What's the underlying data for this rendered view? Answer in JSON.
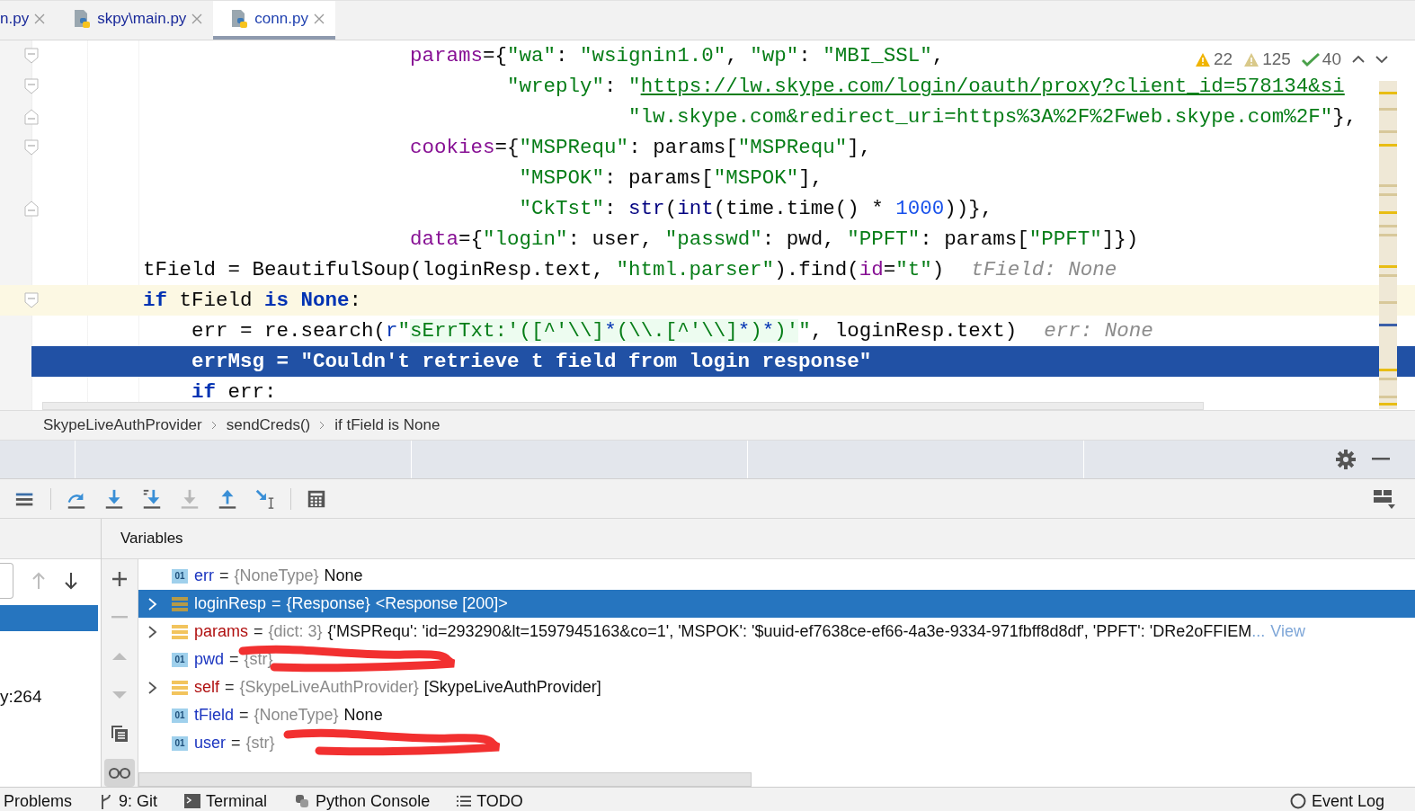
{
  "tabs": [
    {
      "label": "n.py",
      "selected": false,
      "python": false
    },
    {
      "label": "skpy\\main.py",
      "selected": false,
      "python": true
    },
    {
      "label": "conn.py",
      "selected": true,
      "python": true
    }
  ],
  "inspections": [
    {
      "kind": "error",
      "count": "22"
    },
    {
      "kind": "warning",
      "count": "125"
    },
    {
      "kind": "ok",
      "count": "40"
    }
  ],
  "code": [
    {
      "fold_start": true,
      "fold_end": false,
      "current": false,
      "selected": false,
      "tokens": [
        {
          "kind": "param",
          "t": "                      params"
        },
        {
          "kind": "plain",
          "t": "={"
        },
        {
          "kind": "str",
          "t": "\"wa\""
        },
        {
          "kind": "plain",
          "t": ": "
        },
        {
          "kind": "str",
          "t": "\"wsignin1.0\""
        },
        {
          "kind": "plain",
          "t": ", "
        },
        {
          "kind": "str",
          "t": "\"wp\""
        },
        {
          "kind": "plain",
          "t": ": "
        },
        {
          "kind": "str",
          "t": "\"MBI_SSL\""
        },
        {
          "kind": "plain",
          "t": ","
        }
      ]
    },
    {
      "fold_start": true,
      "fold_end": false,
      "current": false,
      "selected": false,
      "tokens": [
        {
          "kind": "str",
          "t": "                              \"wreply\""
        },
        {
          "kind": "plain",
          "t": ": "
        },
        {
          "kind": "str",
          "t": "\""
        },
        {
          "kind": "link",
          "t": "https://lw.skype.com/login/oauth/proxy?client_id=578134&si"
        }
      ]
    },
    {
      "fold_start": false,
      "fold_end": true,
      "current": false,
      "selected": false,
      "tokens": [
        {
          "kind": "str",
          "t": "                                        \"lw.skype.com&redirect_uri=https%3A%2F%2Fweb.skype.com%2F\""
        },
        {
          "kind": "plain",
          "t": "},"
        }
      ]
    },
    {
      "fold_start": true,
      "fold_end": false,
      "current": false,
      "selected": false,
      "tokens": [
        {
          "kind": "param",
          "t": "                      cookies"
        },
        {
          "kind": "plain",
          "t": "={"
        },
        {
          "kind": "str",
          "t": "\"MSPRequ\""
        },
        {
          "kind": "plain",
          "t": ": params["
        },
        {
          "kind": "str",
          "t": "\"MSPRequ\""
        },
        {
          "kind": "plain",
          "t": "],"
        }
      ]
    },
    {
      "fold_start": false,
      "fold_end": false,
      "current": false,
      "selected": false,
      "tokens": [
        {
          "kind": "str",
          "t": "                               \"MSPOK\""
        },
        {
          "kind": "plain",
          "t": ": params["
        },
        {
          "kind": "str",
          "t": "\"MSPOK\""
        },
        {
          "kind": "plain",
          "t": "],"
        }
      ]
    },
    {
      "fold_start": false,
      "fold_end": true,
      "current": false,
      "selected": false,
      "tokens": [
        {
          "kind": "str",
          "t": "                               \"CkTst\""
        },
        {
          "kind": "plain",
          "t": ": "
        },
        {
          "kind": "builtin",
          "t": "str"
        },
        {
          "kind": "plain",
          "t": "("
        },
        {
          "kind": "builtin",
          "t": "int"
        },
        {
          "kind": "plain",
          "t": "(time.time() * "
        },
        {
          "kind": "num",
          "t": "1000"
        },
        {
          "kind": "plain",
          "t": "))},"
        }
      ]
    },
    {
      "fold_start": false,
      "fold_end": false,
      "current": false,
      "selected": false,
      "tokens": [
        {
          "kind": "param",
          "t": "                      data"
        },
        {
          "kind": "plain",
          "t": "={"
        },
        {
          "kind": "str",
          "t": "\"login\""
        },
        {
          "kind": "plain",
          "t": ": user, "
        },
        {
          "kind": "str",
          "t": "\"passwd\""
        },
        {
          "kind": "plain",
          "t": ": pwd, "
        },
        {
          "kind": "str",
          "t": "\"PPFT\""
        },
        {
          "kind": "plain",
          "t": ": params["
        },
        {
          "kind": "str",
          "t": "\"PPFT\""
        },
        {
          "kind": "plain",
          "t": "]})"
        }
      ]
    },
    {
      "fold_start": false,
      "fold_end": false,
      "current": false,
      "selected": false,
      "tokens": [
        {
          "kind": "plain",
          "t": "tField = BeautifulSoup(loginResp.text, "
        },
        {
          "kind": "str",
          "t": "\"html.parser\""
        },
        {
          "kind": "plain",
          "t": ").find("
        },
        {
          "kind": "param",
          "t": "id"
        },
        {
          "kind": "plain",
          "t": "="
        },
        {
          "kind": "str",
          "t": "\"t\""
        },
        {
          "kind": "plain",
          "t": ")"
        }
      ],
      "hint": "tField: None"
    },
    {
      "fold_start": true,
      "fold_end": false,
      "current": true,
      "selected": false,
      "tokens": [
        {
          "kind": "kw",
          "t": "if"
        },
        {
          "kind": "plain",
          "t": " tField "
        },
        {
          "kind": "kw",
          "t": "is None"
        },
        {
          "kind": "plain",
          "t": ":"
        }
      ]
    },
    {
      "fold_start": false,
      "fold_end": false,
      "current": false,
      "selected": false,
      "tokens": [
        {
          "kind": "plain",
          "t": "    err = re.search("
        },
        {
          "kind": "prefix",
          "t": "r"
        },
        {
          "kind": "str",
          "t": "\""
        },
        {
          "kind": "regex",
          "t": "sErrTxt:'([^'\\\\]"
        },
        {
          "kind": "regexop",
          "t": "*"
        },
        {
          "kind": "regex",
          "t": "(\\\\.[^'\\\\]"
        },
        {
          "kind": "regexop",
          "t": "*"
        },
        {
          "kind": "regex",
          "t": ")"
        },
        {
          "kind": "regexop",
          "t": "*"
        },
        {
          "kind": "regex",
          "t": ")'"
        },
        {
          "kind": "str",
          "t": "\""
        },
        {
          "kind": "plain",
          "t": ", loginResp.text)"
        }
      ],
      "hint": "err: None"
    },
    {
      "fold_start": false,
      "fold_end": false,
      "current": false,
      "selected": true,
      "tokens": [
        {
          "kind": "plain",
          "t": "    errMsg = "
        },
        {
          "kind": "str",
          "t": "\"Couldn't retrieve t field from login response\""
        }
      ]
    },
    {
      "fold_start": false,
      "fold_end": false,
      "current": false,
      "selected": false,
      "tokens": [
        {
          "kind": "kw",
          "t": "    if"
        },
        {
          "kind": "plain",
          "t": " err:"
        }
      ]
    }
  ],
  "breadcrumbs": [
    "SkypeLiveAuthProvider",
    "sendCreds()",
    "if tField is None"
  ],
  "toolbar": [
    {
      "kind": "menu",
      "disabled": false
    },
    {
      "kind": "step-over",
      "disabled": false
    },
    {
      "kind": "step-into",
      "disabled": false
    },
    {
      "kind": "step-into-my",
      "disabled": false
    },
    {
      "kind": "force-step",
      "disabled": true
    },
    {
      "kind": "step-out",
      "disabled": false
    },
    {
      "kind": "run-to-cursor",
      "disabled": false
    },
    {
      "kind": "evaluate",
      "disabled": false
    }
  ],
  "frames": {
    "selected_row": true,
    "visible_text": "y:264"
  },
  "side_tools": [
    {
      "kind": "add",
      "disabled": false,
      "on": false
    },
    {
      "kind": "remove",
      "disabled": true,
      "on": false
    },
    {
      "kind": "up",
      "disabled": true,
      "on": false
    },
    {
      "kind": "down",
      "disabled": true,
      "on": false
    },
    {
      "kind": "copy",
      "disabled": false,
      "on": false
    },
    {
      "kind": "watch",
      "disabled": false,
      "on": true
    }
  ],
  "variables_title": "Variables",
  "variables": [
    {
      "kind": "scalar",
      "icon_text": "01",
      "expandable": false,
      "selected": false,
      "name": "err",
      "op": "=",
      "type": "{NoneType}",
      "value": "None",
      "redacted": false
    },
    {
      "kind": "object",
      "expandable": true,
      "selected": true,
      "name": "loginResp",
      "op": "=",
      "type": "{Response}",
      "value": "<Response [200]>",
      "redacted": false
    },
    {
      "kind": "object",
      "expandable": true,
      "selected": false,
      "name": "params",
      "op": "=",
      "type": "{dict: 3}",
      "value": "{'MSPRequ': 'id=293290&lt=1597945163&co=1', 'MSPOK': '$uuid-ef7638ce-ef66-4a3e-9334-971fbff8d8df', 'PPFT': 'DRe2oFFIEM",
      "more": "...",
      "link": "View",
      "redacted": false
    },
    {
      "kind": "scalar",
      "icon_text": "01",
      "expandable": false,
      "selected": false,
      "name": "pwd",
      "op": "=",
      "type": "{str}",
      "redacted": true
    },
    {
      "kind": "object",
      "expandable": true,
      "selected": false,
      "name": "self",
      "op": "=",
      "type": "{SkypeLiveAuthProvider}",
      "value": "[SkypeLiveAuthProvider]",
      "redacted": false
    },
    {
      "kind": "scalar",
      "icon_text": "01",
      "expandable": false,
      "selected": false,
      "name": "tField",
      "op": "=",
      "type": "{NoneType}",
      "value": "None",
      "redacted": false
    },
    {
      "kind": "scalar",
      "icon_text": "01",
      "expandable": false,
      "selected": false,
      "name": "user",
      "op": "=",
      "type": "{str}",
      "redacted": true
    }
  ],
  "bottom_tools": [
    {
      "kind": "problems",
      "label": "Problems"
    },
    {
      "kind": "git",
      "label": "9: Git"
    },
    {
      "kind": "terminal",
      "label": "Terminal"
    },
    {
      "kind": "python",
      "label": "Python Console"
    },
    {
      "kind": "todo",
      "label": "TODO"
    }
  ],
  "event_log": "Event Log"
}
